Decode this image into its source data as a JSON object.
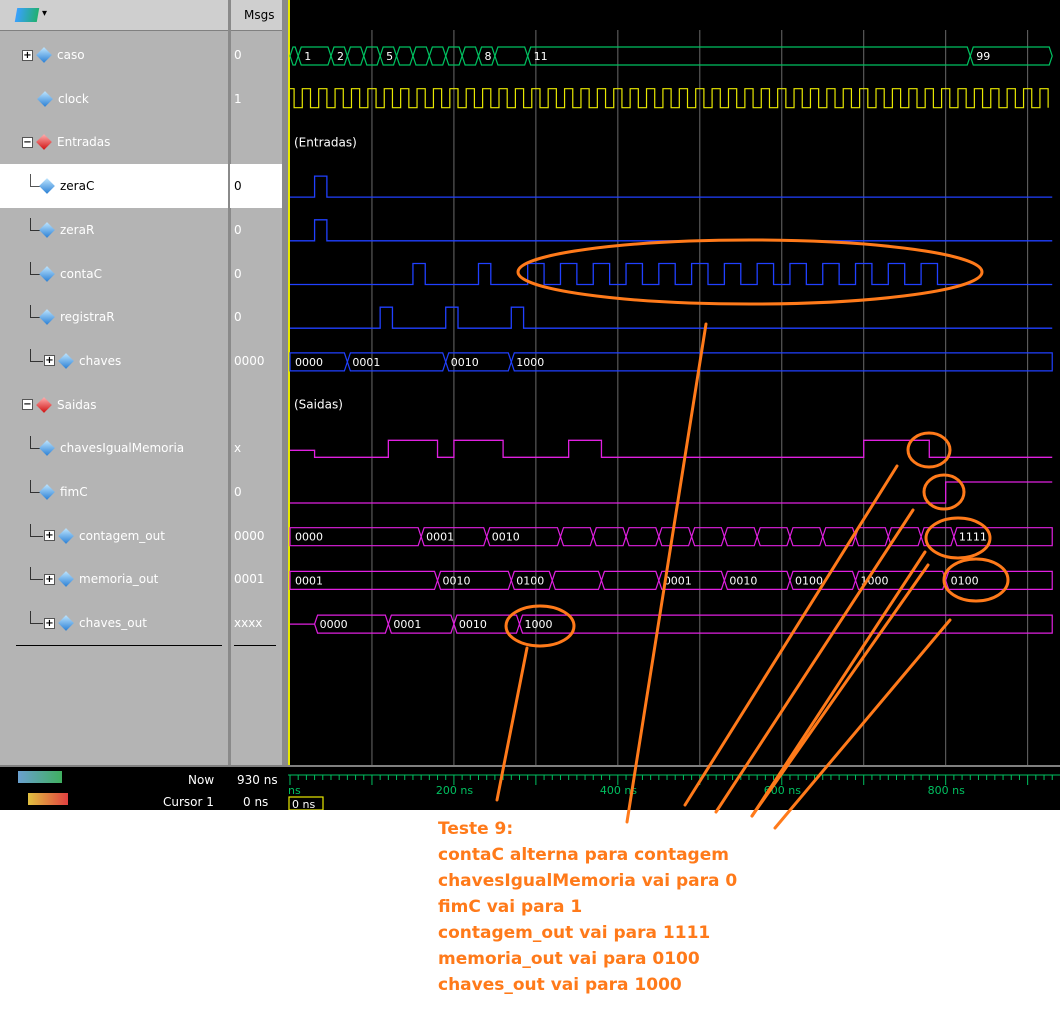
{
  "header": {
    "msgs": "Msgs"
  },
  "signals": [
    {
      "name": "caso",
      "value": "0",
      "expand": "plus",
      "icon": "blue",
      "indent": 0
    },
    {
      "name": "clock",
      "value": "1",
      "expand": "none",
      "icon": "blue",
      "indent": 0
    },
    {
      "name": "Entradas",
      "value": "",
      "expand": "minus",
      "icon": "red",
      "indent": 0
    },
    {
      "name": "zeraC",
      "value": "0",
      "expand": "none",
      "icon": "blue",
      "indent": 1
    },
    {
      "name": "zeraR",
      "value": "0",
      "expand": "none",
      "icon": "blue",
      "indent": 1
    },
    {
      "name": "contaC",
      "value": "0",
      "expand": "none",
      "icon": "blue",
      "indent": 1
    },
    {
      "name": "registraR",
      "value": "0",
      "expand": "none",
      "icon": "blue",
      "indent": 1
    },
    {
      "name": "chaves",
      "value": "0000",
      "expand": "plus",
      "icon": "blue",
      "indent": 1
    },
    {
      "name": "Saidas",
      "value": "",
      "expand": "minus",
      "icon": "red",
      "indent": 0
    },
    {
      "name": "chavesIgualMemoria",
      "value": "x",
      "expand": "none",
      "icon": "blue",
      "indent": 1
    },
    {
      "name": "fimC",
      "value": "0",
      "expand": "none",
      "icon": "blue",
      "indent": 1
    },
    {
      "name": "contagem_out",
      "value": "0000",
      "expand": "plus",
      "icon": "blue",
      "indent": 1
    },
    {
      "name": "memoria_out",
      "value": "0001",
      "expand": "plus",
      "icon": "blue",
      "indent": 1
    },
    {
      "name": "chaves_out",
      "value": "xxxx",
      "expand": "plus",
      "icon": "blue",
      "indent": 1
    }
  ],
  "waves": {
    "caso_labels": [
      "1",
      "2",
      "5",
      "8",
      "11",
      "99"
    ],
    "group_entradas": "(Entradas)",
    "group_saidas": "(Saidas)",
    "chaves_labels": [
      "0000",
      "0001",
      "0010",
      "1000"
    ],
    "contagem_labels": [
      "0000",
      "0001",
      "0010",
      "1111"
    ],
    "memoria_labels": [
      "0001",
      "0010",
      "0100",
      "0001",
      "0010",
      "0100",
      "1000",
      "0100"
    ],
    "chaves_out_labels": [
      "0000",
      "0001",
      "0010",
      "1000"
    ]
  },
  "statusbar": {
    "now_label": "Now",
    "now_value": "930 ns",
    "cursor_label": "Cursor 1",
    "cursor_value": "0 ns",
    "cursor_time": "0 ns",
    "ticks": [
      "ns",
      "200 ns",
      "400 ns",
      "600 ns",
      "800 ns"
    ]
  },
  "annotation": {
    "title": "Teste 9:",
    "lines": [
      "contaC alterna para contagem",
      "chavesIgualMemoria vai para 0",
      "fimC vai para 1",
      "contagem_out vai para 1111",
      "memoria_out vai para 0100",
      "chaves_out vai para 1000"
    ]
  },
  "colors": {
    "accent": "#ff7a1a",
    "green": "#00c060",
    "yellow": "#e8e800",
    "blue": "#2040ff",
    "magenta": "#e020e0"
  }
}
